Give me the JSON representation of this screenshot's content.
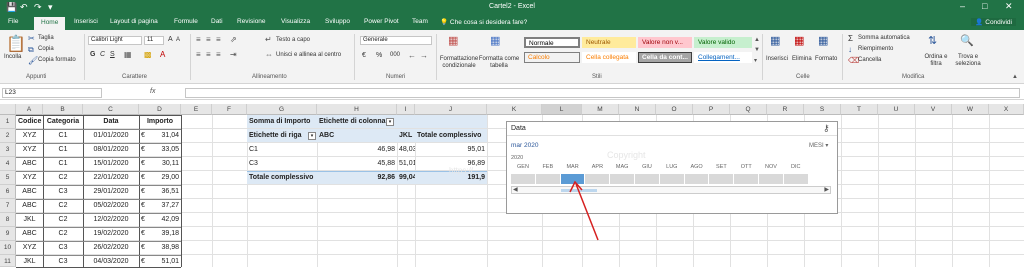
{
  "window": {
    "title": "Cartel2 - Excel",
    "qa_icons": [
      "save-icon",
      "undo-icon",
      "redo-icon",
      "customize-icon"
    ],
    "controls": [
      "minimize-icon",
      "restore-icon",
      "close-icon"
    ]
  },
  "tabs": [
    "File",
    "Home",
    "Inserisci",
    "Layout di pagina",
    "Formule",
    "Dati",
    "Revisione",
    "Visualizza",
    "Sviluppo",
    "Power Pivot",
    "Team"
  ],
  "tell_me": "Che cosa si desidera fare?",
  "share": "Condividi",
  "ribbon": {
    "clipboard": {
      "paste": "Incolla",
      "cut": "Taglia",
      "copy": "Copia",
      "format_painter": "Copia formato",
      "label": "Appunti"
    },
    "font": {
      "name": "Calibri Light",
      "size": "11",
      "grow": "A",
      "shrink": "A",
      "label": "Carattere",
      "bold": "G",
      "italic": "C",
      "underline": "S"
    },
    "alignment": {
      "wrap": "Testo a capo",
      "merge": "Unisci e allinea al centro",
      "label": "Allineamento"
    },
    "number": {
      "format": "Generale",
      "currency": "€",
      "percent": "%",
      "thousands": "000",
      "label": "Numeri"
    },
    "styles": {
      "conditional": "Formattazione condizionale",
      "table": "Formatta come tabella",
      "label": "Stili",
      "boxes": [
        {
          "text": "Normale",
          "bg": "#ffffff",
          "fg": "#000000",
          "border": "#7f7f7f"
        },
        {
          "text": "Neutrale",
          "bg": "#ffeb9c",
          "fg": "#9c5700",
          "border": "#ffeb9c"
        },
        {
          "text": "Valore non v...",
          "bg": "#ffc7ce",
          "fg": "#9c0006",
          "border": "#ffc7ce"
        },
        {
          "text": "Valore valido",
          "bg": "#c6efce",
          "fg": "#006100",
          "border": "#c6efce"
        },
        {
          "text": "Calcolo",
          "bg": "#f2f2f2",
          "fg": "#fa7d00",
          "border": "#7f7f7f"
        },
        {
          "text": "Cella collegata",
          "bg": "#ffffff",
          "fg": "#fa7d00",
          "border": "#ffffff"
        },
        {
          "text": "Cella da cont...",
          "bg": "#a5a5a5",
          "fg": "#ffffff",
          "border": "#3f3f3f"
        },
        {
          "text": "Collegament...",
          "bg": "#ffffff",
          "fg": "#0563c1",
          "border": "#ffffff"
        }
      ]
    },
    "cells": {
      "insert": "Inserisci",
      "delete": "Elimina",
      "format": "Formato",
      "label": "Celle"
    },
    "editing": {
      "autosum": "Somma automatica",
      "fill": "Riempimento",
      "clear": "Cancella",
      "sort": "Ordina e filtra",
      "find": "Trova e seleziona",
      "label": "Modifica"
    }
  },
  "formula_bar": {
    "name_box": "L23",
    "fx": "fx",
    "value": ""
  },
  "columns": [
    "A",
    "B",
    "C",
    "D",
    "E",
    "F",
    "G",
    "H",
    "I",
    "J",
    "K",
    "L",
    "M",
    "N",
    "O",
    "P",
    "Q",
    "R",
    "S",
    "T",
    "U",
    "V",
    "W",
    "X"
  ],
  "rows": [
    "1",
    "2",
    "3",
    "4",
    "5",
    "6",
    "7",
    "8",
    "9",
    "10",
    "11"
  ],
  "table": {
    "headers": [
      "Codice",
      "Categoria",
      "Data",
      "Importo"
    ],
    "rows": [
      [
        "XYZ",
        "C1",
        "01/01/2020",
        "€",
        "31,04"
      ],
      [
        "XYZ",
        "C1",
        "08/01/2020",
        "€",
        "33,05"
      ],
      [
        "ABC",
        "C1",
        "15/01/2020",
        "€",
        "30,11"
      ],
      [
        "XYZ",
        "C2",
        "22/01/2020",
        "€",
        "29,00"
      ],
      [
        "ABC",
        "C3",
        "29/01/2020",
        "€",
        "36,51"
      ],
      [
        "ABC",
        "C2",
        "05/02/2020",
        "€",
        "37,27"
      ],
      [
        "JKL",
        "C2",
        "12/02/2020",
        "€",
        "42,09"
      ],
      [
        "ABC",
        "C2",
        "19/02/2020",
        "€",
        "39,18"
      ],
      [
        "XYZ",
        "C3",
        "26/02/2020",
        "€",
        "38,98"
      ],
      [
        "JKL",
        "C3",
        "04/03/2020",
        "€",
        "51,01"
      ]
    ]
  },
  "pivot": {
    "sum_label": "Somma di Importo",
    "col_label": "Etichette di colonna",
    "row_label": "Etichette di riga",
    "col_headers": [
      "ABC",
      "JKL",
      "Totale complessivo"
    ],
    "rows": [
      [
        "C1",
        "46,98",
        "48,03",
        "95,01"
      ],
      [
        "C3",
        "45,88",
        "51,01",
        "96,89"
      ]
    ],
    "total": [
      "Totale complessivo",
      "92,86",
      "99,04",
      "191,9"
    ]
  },
  "slicer": {
    "title": "Data",
    "selection": "mar 2020",
    "level": "MESI",
    "year": "2020",
    "months": [
      "GEN",
      "FEB",
      "MAR",
      "APR",
      "MAG",
      "GIU",
      "LUG",
      "AGO",
      "SET",
      "OTT",
      "NOV",
      "DIC"
    ],
    "selected_month_index": 2,
    "watermark": "Copyright",
    "watermark2": "https://..."
  },
  "annotation": {
    "color": "#d62020"
  }
}
